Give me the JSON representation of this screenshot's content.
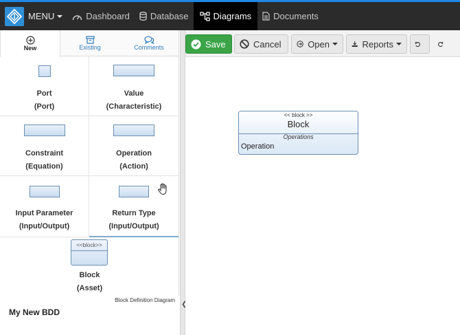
{
  "nav": {
    "menu": "MENU",
    "items": [
      {
        "label": "Dashboard",
        "icon": "dashboard-icon"
      },
      {
        "label": "Database",
        "icon": "database-icon"
      },
      {
        "label": "Diagrams",
        "icon": "diagram-icon",
        "active": true
      },
      {
        "label": "Documents",
        "icon": "document-icon"
      }
    ]
  },
  "left_tabs": [
    {
      "label": "New",
      "icon": "plus-circle-icon",
      "active": true
    },
    {
      "label": "Existing",
      "icon": "archive-icon"
    },
    {
      "label": "Comments",
      "icon": "comments-icon"
    }
  ],
  "palette": [
    {
      "title": "Port",
      "subtitle": "(Port)"
    },
    {
      "title": "Value",
      "subtitle": "(Characteristic)"
    },
    {
      "title": "Constraint",
      "subtitle": "(Equation)"
    },
    {
      "title": "Operation",
      "subtitle": "(Action)"
    },
    {
      "title": "Input Parameter",
      "subtitle": "(Input/Output)"
    },
    {
      "title": "Return Type",
      "subtitle": "(Input/Output)"
    },
    {
      "title": "Block",
      "subtitle": "(Asset)",
      "stereotype": "<<block>>"
    }
  ],
  "footer": {
    "type_label": "Block Definition Diagram",
    "diagram_name": "My New BDD"
  },
  "toolbar": {
    "save": "Save",
    "cancel": "Cancel",
    "open": "Open",
    "reports": "Reports"
  },
  "canvas_block": {
    "stereotype": "<< block >>",
    "name": "Block",
    "section": "Operations",
    "operation": "Operation"
  },
  "colors": {
    "accent": "#1e88e5",
    "save_green": "#3aa447",
    "nav_bg": "#2b2b2b"
  }
}
